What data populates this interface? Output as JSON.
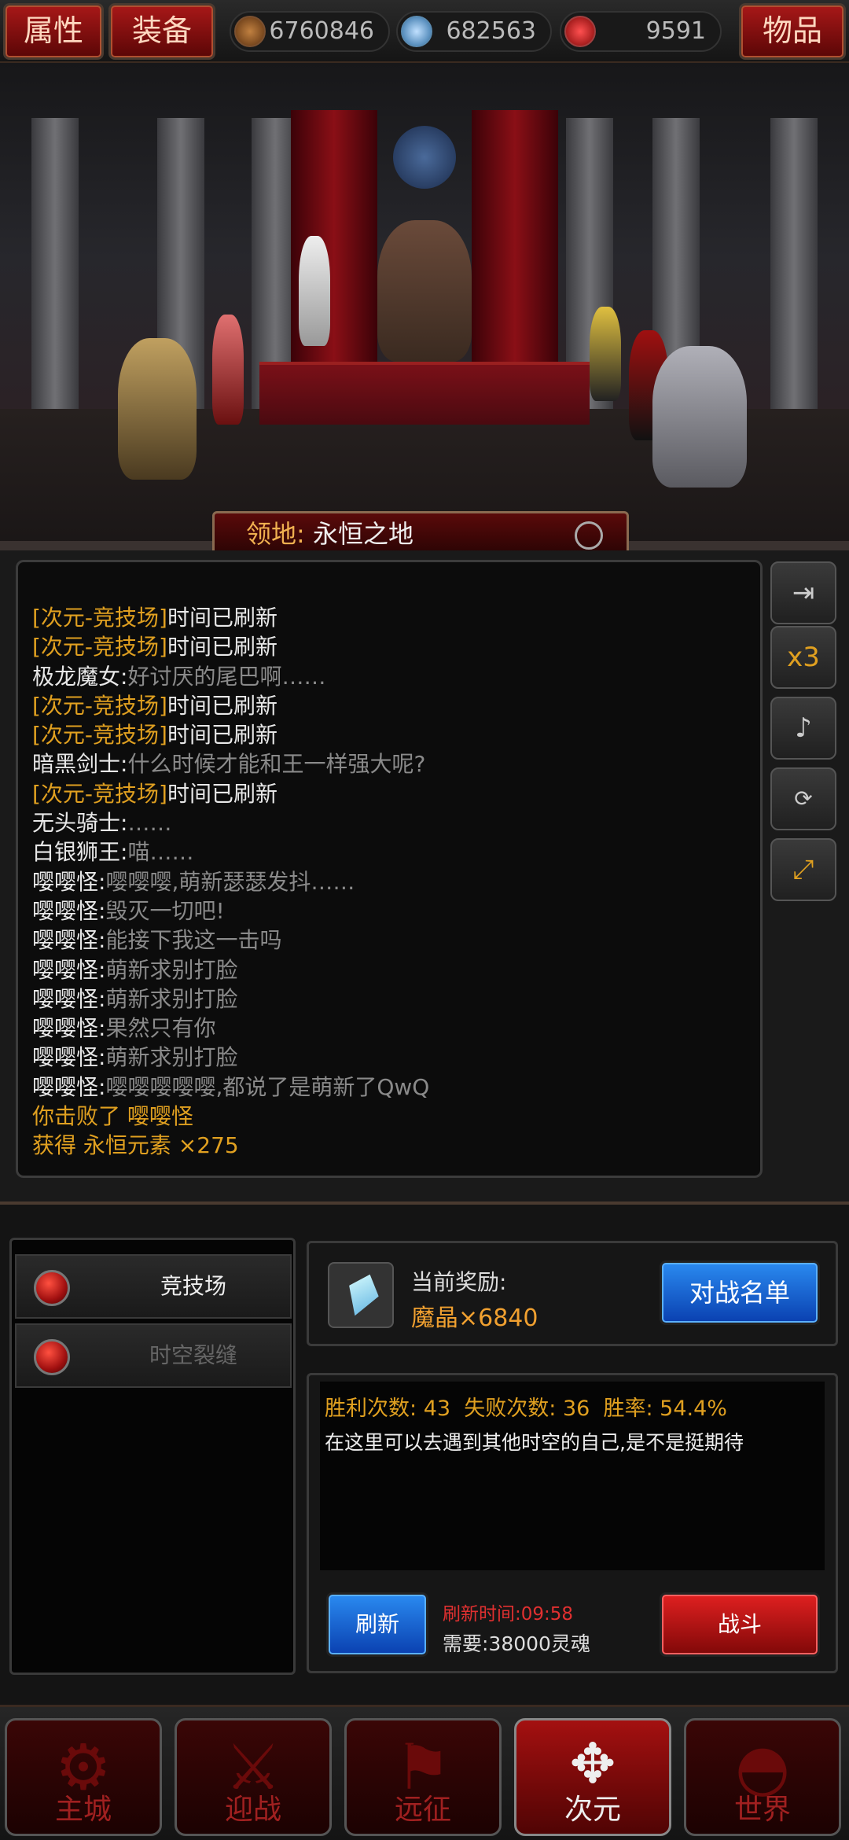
{
  "topbar": {
    "attr_label": "属性",
    "equip_label": "装备",
    "items_label": "物品",
    "gold": "6760846",
    "gems": "682563",
    "soul": "9591"
  },
  "scene": {
    "territory_key": "领地:",
    "territory_name": "永恒之地"
  },
  "log": [
    {
      "tag": "[次元-竞技场]",
      "text": "时间已刷新"
    },
    {
      "tag": "[次元-竞技场]",
      "text": "时间已刷新"
    },
    {
      "name": "极龙魔女:",
      "text": "好讨厌的尾巴啊……"
    },
    {
      "tag": "[次元-竞技场]",
      "text": "时间已刷新"
    },
    {
      "tag": "[次元-竞技场]",
      "text": "时间已刷新"
    },
    {
      "name": "暗黑剑士:",
      "text": "什么时候才能和王一样强大呢?"
    },
    {
      "tag": "[次元-竞技场]",
      "text": "时间已刷新"
    },
    {
      "name": "无头骑士:",
      "text": "……"
    },
    {
      "name": "白银狮王:",
      "text": "喵……"
    },
    {
      "name": "嘤嘤怪:",
      "text": "嘤嘤嘤,萌新瑟瑟发抖……"
    },
    {
      "name": "嘤嘤怪:",
      "text": "毁灭一切吧!"
    },
    {
      "name": "嘤嘤怪:",
      "text": "能接下我这一击吗"
    },
    {
      "name": "嘤嘤怪:",
      "text": "萌新求别打脸"
    },
    {
      "name": "嘤嘤怪:",
      "text": "萌新求别打脸"
    },
    {
      "name": "嘤嘤怪:",
      "text": "果然只有你"
    },
    {
      "name": "嘤嘤怪:",
      "text": "萌新求别打脸"
    },
    {
      "name": "嘤嘤怪:",
      "text": "嘤嘤嘤嘤嘤,都说了是萌新了QwQ"
    },
    {
      "gold": "你击败了 嘤嘤怪"
    },
    {
      "gold": "获得 永恒元素 ×275"
    }
  ],
  "side": {
    "speed": "x3"
  },
  "menu": {
    "arena": "竞技场",
    "rift": "时空裂缝"
  },
  "reward": {
    "label": "当前奖励:",
    "value": "魔晶×6840",
    "list_button": "对战名单"
  },
  "stats": {
    "wins_label": "胜利次数:",
    "wins": "43",
    "losses_label": "失败次数:",
    "losses": "36",
    "rate_label": "胜率:",
    "rate": "54.4%",
    "desc": "在这里可以去遇到其他时空的自己,是不是挺期待",
    "refresh_button": "刷新",
    "refresh_time": "刷新时间:09:58",
    "cost": "需要:38000灵魂",
    "fight_button": "战斗"
  },
  "nav": [
    "主城",
    "迎战",
    "远征",
    "次元",
    "世界"
  ],
  "colors": {
    "gold_text": "#e0a020",
    "active_red": "#a41010"
  }
}
